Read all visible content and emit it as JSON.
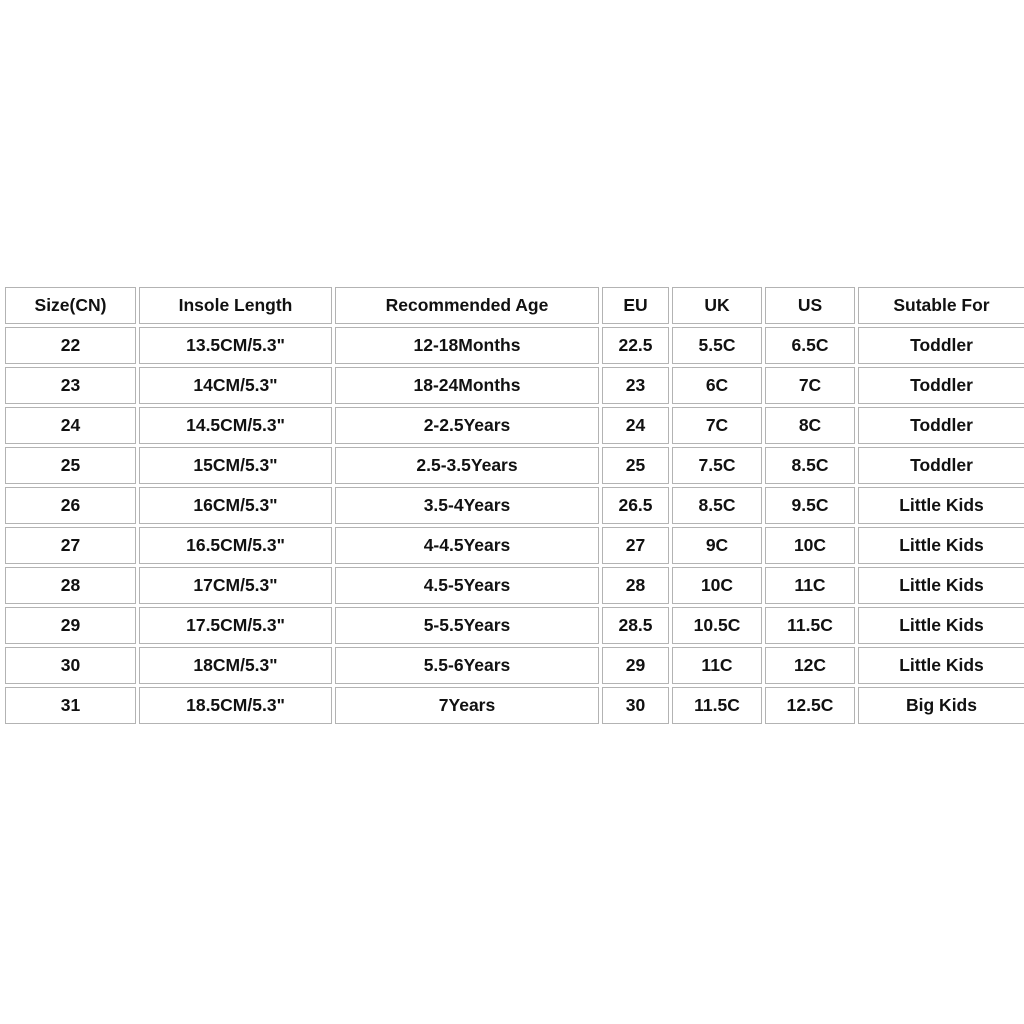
{
  "table": {
    "headers": [
      "Size(CN)",
      "Insole Length",
      "Recommended Age",
      "EU",
      "UK",
      "US",
      "Sutable For"
    ],
    "rows": [
      [
        "22",
        "13.5CM/5.3\"",
        "12-18Months",
        "22.5",
        "5.5C",
        "6.5C",
        "Toddler"
      ],
      [
        "23",
        "14CM/5.3\"",
        "18-24Months",
        "23",
        "6C",
        "7C",
        "Toddler"
      ],
      [
        "24",
        "14.5CM/5.3\"",
        "2-2.5Years",
        "24",
        "7C",
        "8C",
        "Toddler"
      ],
      [
        "25",
        "15CM/5.3\"",
        "2.5-3.5Years",
        "25",
        "7.5C",
        "8.5C",
        "Toddler"
      ],
      [
        "26",
        "16CM/5.3\"",
        "3.5-4Years",
        "26.5",
        "8.5C",
        "9.5C",
        "Little Kids"
      ],
      [
        "27",
        "16.5CM/5.3\"",
        "4-4.5Years",
        "27",
        "9C",
        "10C",
        "Little Kids"
      ],
      [
        "28",
        "17CM/5.3\"",
        "4.5-5Years",
        "28",
        "10C",
        "11C",
        "Little Kids"
      ],
      [
        "29",
        "17.5CM/5.3\"",
        "5-5.5Years",
        "28.5",
        "10.5C",
        "11.5C",
        "Little Kids"
      ],
      [
        "30",
        "18CM/5.3\"",
        "5.5-6Years",
        "29",
        "11C",
        "12C",
        "Little Kids"
      ],
      [
        "31",
        "18.5CM/5.3\"",
        "7Years",
        "30",
        "11.5C",
        "12.5C",
        "Big Kids"
      ]
    ]
  },
  "colors": {
    "background": "#ffffff",
    "cell_background": "#ffffff",
    "cell_border": "#b3b3b3",
    "text": "#111111"
  }
}
